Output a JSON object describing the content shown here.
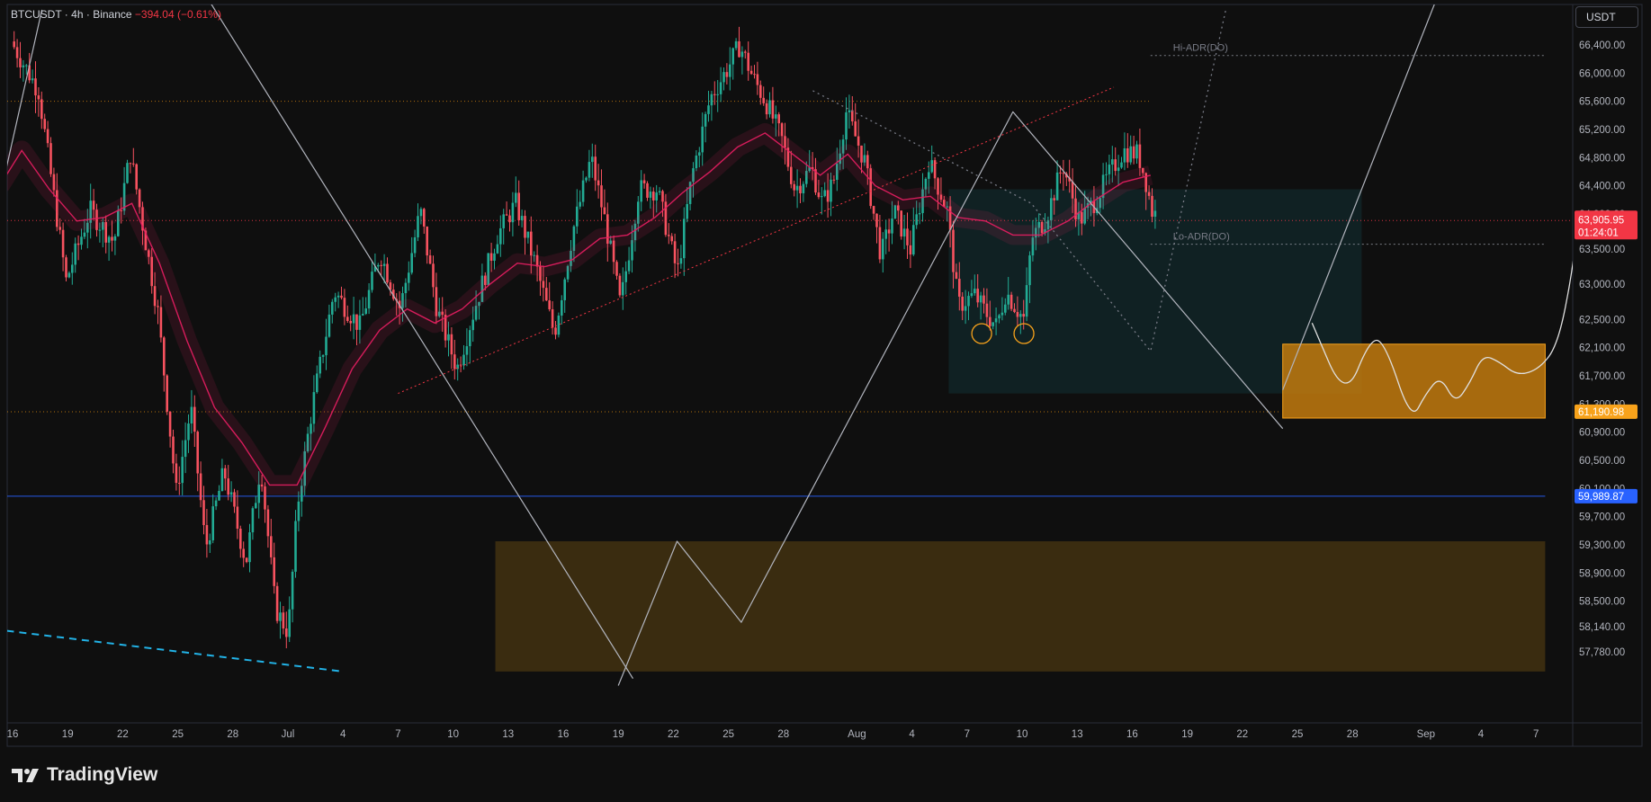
{
  "header": {
    "symbol": "BTCUSDT",
    "separator1": "·",
    "interval": "4h",
    "separator2": "·",
    "exchange": "Binance",
    "change": "−394.04 (−0.61%)"
  },
  "toolbar": {
    "currency_button": "USDT"
  },
  "brand": {
    "name": "TradingView"
  },
  "colors": {
    "background": "#0f0f0f",
    "up_candle": "#22ab94",
    "down_candle": "#f7525f",
    "ma_line": "#e91e63",
    "current_price_tag": "#f23645",
    "support_zone": "#c27a0e",
    "demand_zone": "#3a2c10",
    "range_box": "#12282b",
    "blue_level": "#2962ff"
  },
  "chart_data": {
    "type": "candlestick",
    "symbol": "BTCUSDT",
    "interval": "4h",
    "exchange": "Binance",
    "ylim": [
      57500,
      66900
    ],
    "y_ticks": [
      66400,
      66000,
      65600,
      65200,
      64800,
      64400,
      64000,
      63500,
      63000,
      62500,
      62100,
      61700,
      61300,
      60900,
      60500,
      60100,
      59700,
      59300,
      58900,
      58500,
      58140,
      57780
    ],
    "y_tick_labels": [
      "66,400.00",
      "66,000.00",
      "65,600.00",
      "65,200.00",
      "64,800.00",
      "64,400.00",
      "64,000.00",
      "63,500.00",
      "63,000.00",
      "62,500.00",
      "62,100.00",
      "61,700.00",
      "61,300.00",
      "60,900.00",
      "60,500.00",
      "60,100.00",
      "59,700.00",
      "59,300.00",
      "58,900.00",
      "58,500.00",
      "58,140.00",
      "57,780.00"
    ],
    "x_ticks": [
      "16",
      "19",
      "22",
      "25",
      "28",
      "Jul",
      "4",
      "7",
      "10",
      "13",
      "16",
      "19",
      "22",
      "25",
      "28",
      "Aug",
      "4",
      "7",
      "10",
      "13",
      "16",
      "19",
      "22",
      "25",
      "28",
      "Sep",
      "4",
      "7"
    ],
    "price_path": [
      [
        16,
        66450
      ],
      [
        17.5,
        65750
      ],
      [
        19,
        63050
      ],
      [
        20.3,
        64050
      ],
      [
        21.6,
        63600
      ],
      [
        22.5,
        64850
      ],
      [
        24,
        62600
      ],
      [
        25,
        60050
      ],
      [
        25.8,
        61250
      ],
      [
        26.6,
        59250
      ],
      [
        27.6,
        60350
      ],
      [
        28.8,
        59050
      ],
      [
        29.6,
        60450
      ],
      [
        30.4,
        58400
      ],
      [
        31.1,
        58050
      ],
      [
        31.6,
        59850
      ],
      [
        32.4,
        61250
      ],
      [
        33.6,
        62900
      ],
      [
        35,
        62400
      ],
      [
        36.1,
        63450
      ],
      [
        37.2,
        62650
      ],
      [
        38.3,
        64050
      ],
      [
        39.2,
        62650
      ],
      [
        40.3,
        61800
      ],
      [
        41.3,
        62700
      ],
      [
        42.5,
        63700
      ],
      [
        43.5,
        64150
      ],
      [
        44.6,
        63250
      ],
      [
        45.6,
        62300
      ],
      [
        46.6,
        63750
      ],
      [
        47.6,
        64800
      ],
      [
        48.4,
        63850
      ],
      [
        49.2,
        62700
      ],
      [
        50.2,
        64350
      ],
      [
        51.2,
        64350
      ],
      [
        52.3,
        63150
      ],
      [
        53.1,
        64550
      ],
      [
        54.1,
        65650
      ],
      [
        55,
        66050
      ],
      [
        55.7,
        66400
      ],
      [
        56.4,
        65950
      ],
      [
        57.2,
        65550
      ],
      [
        58,
        65050
      ],
      [
        58.7,
        64350
      ],
      [
        59.6,
        64650
      ],
      [
        60.2,
        64150
      ],
      [
        60.8,
        64450
      ],
      [
        61.5,
        65450
      ],
      [
        62.5,
        64750
      ],
      [
        63.4,
        63400
      ],
      [
        64.1,
        64050
      ],
      [
        65,
        63500
      ],
      [
        66,
        64750
      ],
      [
        67,
        64050
      ],
      [
        67.6,
        62700
      ],
      [
        68.5,
        62850
      ],
      [
        69.1,
        62600
      ],
      [
        69.7,
        62400
      ],
      [
        70.2,
        62900
      ],
      [
        70.8,
        62650
      ],
      [
        71.2,
        62500
      ],
      [
        71.6,
        63650
      ],
      [
        72.4,
        63950
      ],
      [
        73.3,
        64700
      ],
      [
        74.2,
        63900
      ],
      [
        75.1,
        64200
      ],
      [
        75.8,
        64550
      ],
      [
        76.6,
        64900
      ],
      [
        77.4,
        64850
      ],
      [
        77.8,
        64500
      ],
      [
        78.2,
        64000
      ]
    ],
    "ma_path": [
      [
        15.3,
        64400
      ],
      [
        16.5,
        64900
      ],
      [
        18,
        64350
      ],
      [
        19.5,
        63900
      ],
      [
        21,
        63950
      ],
      [
        22.5,
        64150
      ],
      [
        24,
        63300
      ],
      [
        25.5,
        62200
      ],
      [
        27,
        61250
      ],
      [
        28.5,
        60750
      ],
      [
        30,
        60150
      ],
      [
        31.5,
        60150
      ],
      [
        33,
        60950
      ],
      [
        34.5,
        61800
      ],
      [
        36,
        62350
      ],
      [
        37.5,
        62650
      ],
      [
        39,
        62450
      ],
      [
        40.5,
        62650
      ],
      [
        42,
        63000
      ],
      [
        43.5,
        63300
      ],
      [
        45,
        63250
      ],
      [
        46.5,
        63350
      ],
      [
        48,
        63650
      ],
      [
        49.5,
        63700
      ],
      [
        51,
        63950
      ],
      [
        52.5,
        64300
      ],
      [
        54,
        64600
      ],
      [
        55.5,
        64950
      ],
      [
        57,
        65150
      ],
      [
        58.5,
        64850
      ],
      [
        60,
        64550
      ],
      [
        61.5,
        64850
      ],
      [
        63,
        64400
      ],
      [
        64.5,
        64200
      ],
      [
        66,
        64250
      ],
      [
        67.5,
        63950
      ],
      [
        69,
        63900
      ],
      [
        70.5,
        63700
      ],
      [
        72,
        63700
      ],
      [
        73.5,
        63900
      ],
      [
        75,
        64200
      ],
      [
        76.5,
        64450
      ],
      [
        78,
        64550
      ]
    ],
    "last_price": 63905.95,
    "last_price_label": "63,905.95",
    "countdown": "01:24:01",
    "levels": [
      {
        "name": "Hi-ADR(DO)",
        "value": 66250,
        "x_start": 78,
        "x_end": 99.5
      },
      {
        "name": "Lo-ADR(DO)",
        "value": 63570,
        "x_start": 78,
        "x_end": 99.5
      },
      {
        "name": "resistance-dotted",
        "value": 65600,
        "x_start": 15,
        "x_end": 78
      },
      {
        "name": "support-dotted",
        "value": 61190,
        "x_start": 15,
        "x_end": 85
      },
      {
        "name": "blue-level",
        "value": 59989.87,
        "x_start": 15,
        "x_end": 99.5
      }
    ],
    "price_tags": [
      {
        "value": 61190.98,
        "label": "61,190.98",
        "color": "#f7a21b"
      },
      {
        "value": 59989.87,
        "label": "59,989.87",
        "color": "#2962ff"
      }
    ],
    "zones": [
      {
        "name": "range-box",
        "x": [
          67,
          89.5
        ],
        "y": [
          61450,
          64350
        ]
      },
      {
        "name": "support-zone",
        "x": [
          85.2,
          99.5
        ],
        "y": [
          61100,
          62150
        ]
      },
      {
        "name": "demand-zone",
        "x": [
          42.3,
          99.5
        ],
        "y": [
          57500,
          59350
        ]
      }
    ],
    "trendlines": [
      {
        "name": "descending-line",
        "points": [
          [
            26.3,
            67200
          ],
          [
            49.8,
            57400
          ]
        ]
      },
      {
        "name": "zigzag-projection",
        "points": [
          [
            49,
            57300
          ],
          [
            52.2,
            59350
          ],
          [
            55.7,
            58200
          ],
          [
            70.5,
            65450
          ],
          [
            85.2,
            60950
          ]
        ]
      },
      {
        "name": "rising-channel",
        "points": [
          [
            37,
            61450
          ],
          [
            76,
            65800
          ]
        ]
      },
      {
        "name": "steep-rise",
        "points": [
          [
            85.2,
            61500
          ],
          [
            93.8,
            67200
          ]
        ]
      },
      {
        "name": "left-rise",
        "points": [
          [
            15.1,
            64000
          ],
          [
            17.6,
            66900
          ]
        ]
      },
      {
        "name": "dotted-v",
        "points": [
          [
            59.6,
            65750
          ],
          [
            71.5,
            64150
          ],
          [
            78,
            62050
          ],
          [
            82.1,
            66900
          ]
        ]
      },
      {
        "name": "cyan-dashed",
        "points": [
          [
            15,
            58100
          ],
          [
            34,
            57500
          ]
        ]
      }
    ],
    "sketch_path": [
      [
        86.8,
        62450
      ],
      [
        88.6,
        61350
      ],
      [
        90,
        62250
      ],
      [
        90.8,
        62150
      ],
      [
        92.2,
        61050
      ],
      [
        93,
        61450
      ],
      [
        93.8,
        61700
      ],
      [
        94.6,
        61300
      ],
      [
        95.4,
        61600
      ],
      [
        96.1,
        62000
      ],
      [
        97,
        61900
      ],
      [
        98,
        61700
      ],
      [
        99.2,
        61800
      ],
      [
        100.2,
        62150
      ],
      [
        101,
        63200
      ],
      [
        101.4,
        64200
      ],
      [
        101.9,
        65000
      ],
      [
        102,
        65200
      ],
      [
        101.9,
        65250
      ]
    ],
    "bottom_markers": [
      [
        68.8,
        62300
      ],
      [
        71.1,
        62300
      ]
    ]
  }
}
